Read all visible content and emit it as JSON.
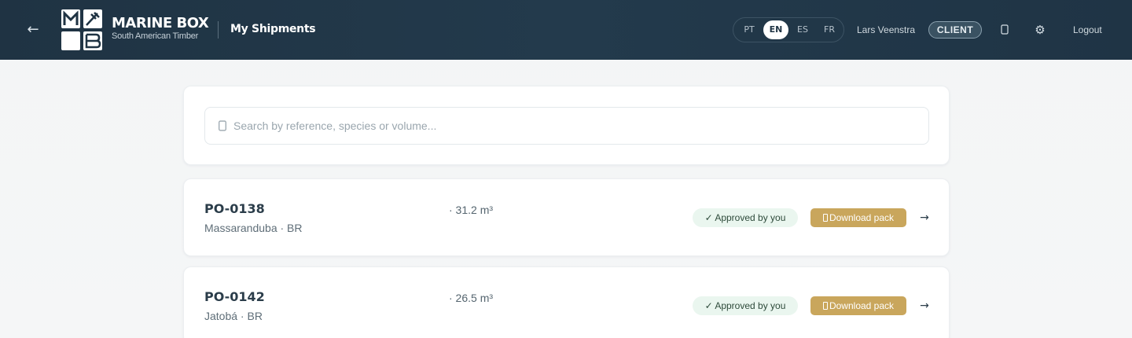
{
  "header": {
    "back_icon": "arrow-left-icon",
    "brand": {
      "name": "MARINE BOX",
      "subtitle": "South American Timber",
      "logo_letters": [
        "M",
        "B"
      ]
    },
    "page_title": "My Shipments",
    "languages": [
      {
        "code": "PT",
        "active": false
      },
      {
        "code": "EN",
        "active": true
      },
      {
        "code": "ES",
        "active": false
      },
      {
        "code": "FR",
        "active": false
      }
    ],
    "user_name": "Lars Veenstra",
    "role": "CLIENT",
    "notification_icon": "bell-icon",
    "settings_icon": "gear-icon",
    "settings_glyph": "⚙",
    "logout_label": "Logout"
  },
  "search": {
    "icon": "search-icon",
    "placeholder": "Search by reference, species or volume...",
    "value": ""
  },
  "shipments": [
    {
      "ref": "PO-0138",
      "volume": "· 31.2 m³",
      "species": "Massaranduba · BR",
      "status": "✓ Approved by you",
      "download_label": "Download pack",
      "arrow": "→"
    },
    {
      "ref": "PO-0142",
      "volume": "· 26.5 m³",
      "species": "Jatobá · BR",
      "status": "✓ Approved by you",
      "download_label": "Download pack",
      "arrow": "→"
    }
  ],
  "colors": {
    "header_bg": "#1f3343",
    "accent_gold": "#c9a65c",
    "approved_bg": "#eaf6ef"
  }
}
